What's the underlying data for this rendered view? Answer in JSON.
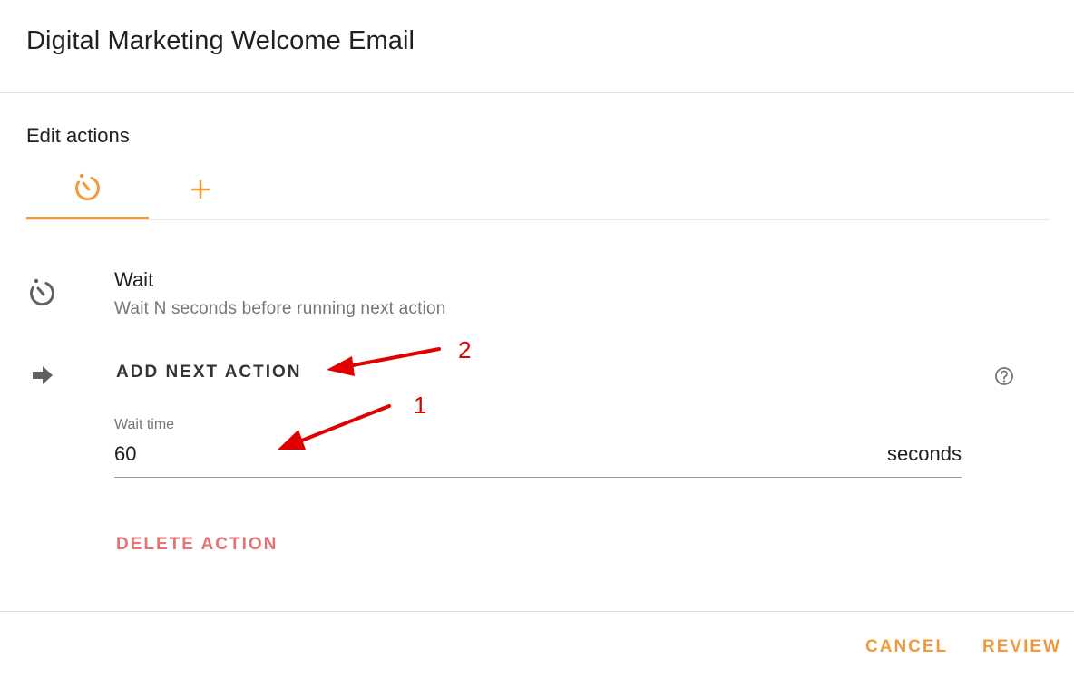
{
  "dialog": {
    "title": "Digital Marketing Welcome Email",
    "section_label": "Edit actions"
  },
  "tabs": [
    {
      "icon": "timer-icon",
      "active": true
    },
    {
      "icon": "plus-icon",
      "active": false
    }
  ],
  "action": {
    "title": "Wait",
    "description": "Wait N seconds before running next action",
    "icon": "timer-icon"
  },
  "next_action": {
    "label": "ADD NEXT ACTION",
    "icon": "arrow-right-icon",
    "help_icon": "help-circle-icon"
  },
  "wait_field": {
    "label": "Wait time",
    "value": "60",
    "suffix": "seconds"
  },
  "delete_label": "DELETE ACTION",
  "footer": {
    "cancel_label": "CANCEL",
    "review_label": "REVIEW"
  },
  "annotations": [
    {
      "number": "1"
    },
    {
      "number": "2"
    }
  ],
  "colors": {
    "accent": "#ef9a3c",
    "danger": "#e57373",
    "annotation": "#e00000"
  }
}
